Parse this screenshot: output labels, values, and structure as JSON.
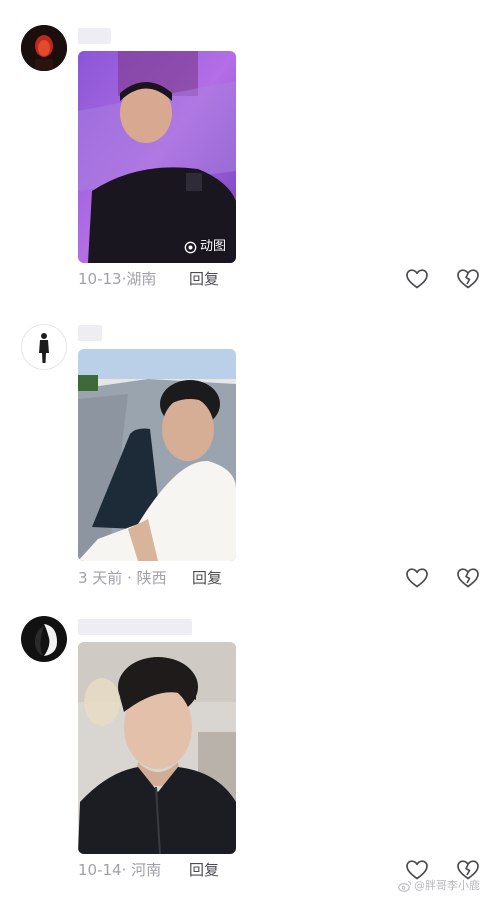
{
  "comments": [
    {
      "meta": "10-13·湖南",
      "reply_label": "回复",
      "badge": "动图"
    },
    {
      "meta": "3 天前 · 陕西",
      "reply_label": "回复"
    },
    {
      "meta": "10-14· 河南",
      "reply_label": "回复"
    }
  ],
  "watermark": "@胖哥李小鹿",
  "icons": {
    "like": "heart-outline-icon",
    "dislike": "broken-heart-icon",
    "gif": "gif-ring-icon",
    "weibo": "weibo-icon"
  },
  "colors": {
    "meta_text": "#a0a0a8",
    "reply_text": "#4d4d55",
    "icon_stroke": "#4a4a52"
  }
}
